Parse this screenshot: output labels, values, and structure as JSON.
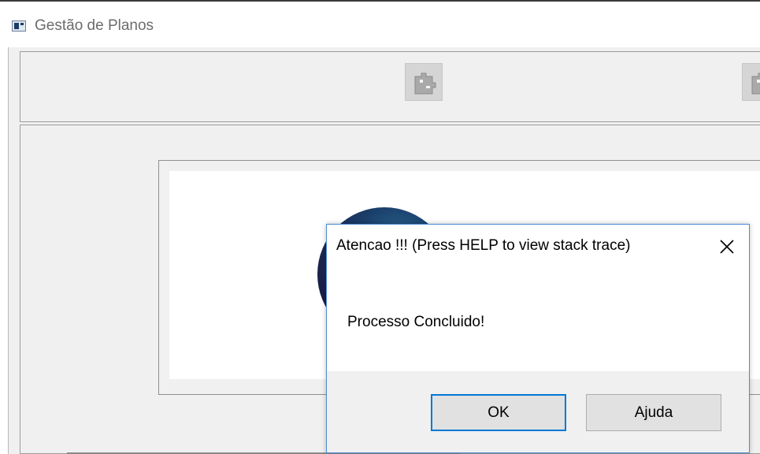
{
  "window": {
    "title": "Gestão de Planos",
    "toolbar": {
      "buttons": [
        {
          "icon": "puzzle-icon",
          "enabled": false
        },
        {
          "icon": "puzzle-icon",
          "enabled": false
        }
      ]
    }
  },
  "dialog": {
    "title": "Atencao !!! (Press HELP to view stack trace)",
    "message": "Processo Concluido!",
    "ok_label": "OK",
    "help_label": "Ajuda",
    "accent_color": "#0078d7"
  }
}
